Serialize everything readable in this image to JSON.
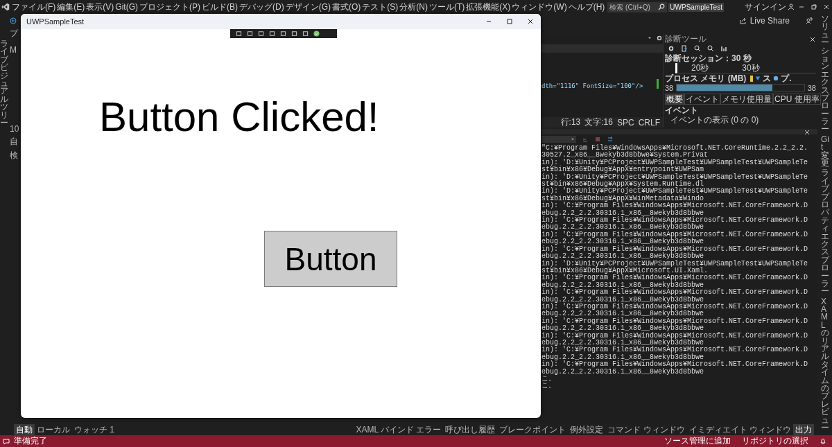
{
  "ide": {
    "menu": [
      "ファイル(F)",
      "編集(E)",
      "表示(V)",
      "Git(G)",
      "プロジェクト(P)",
      "ビルド(B)",
      "デバッグ(D)",
      "デザイン(G)",
      "書式(O)",
      "テスト(S)",
      "分析(N)",
      "ツール(T)",
      "拡張機能(X)",
      "ウィンドウ(W)",
      "ヘルプ(H)"
    ],
    "search": {
      "placeholder": "検索 (Ctrl+Q)"
    },
    "solution_name": "UWPSampleTest",
    "sign_in": "サインイン",
    "live_share": "Live Share",
    "left_tool_tab": "ライブビジュアルツリー",
    "left_fragments": [
      "プ",
      "M",
      "10",
      "自",
      "検"
    ],
    "editor": {
      "code_line": "dth=\"1116\" FontSize=\"100\"/>",
      "status": [
        "行:13",
        "文字:16",
        "SPC",
        "CRLF"
      ]
    },
    "diagnostics": {
      "title": "診断ツール",
      "session": "診断セッション：30 秒",
      "timeline_ticks": [
        "20秒",
        "30秒"
      ],
      "memory_title": "プロセス メモリ (MB)",
      "legend": [
        {
          "kind": "flag",
          "color": "#e8c43a"
        },
        {
          "kind": "triangle",
          "color": "#3c8fe0",
          "label": "ス"
        },
        {
          "kind": "circle",
          "color": "#6aaee6",
          "label": "プ."
        }
      ],
      "memory": {
        "min": "38",
        "max": "38",
        "level": 0.75
      },
      "tabs": [
        {
          "label": "概要",
          "selected": true
        },
        {
          "label": "イベント",
          "selected": false
        },
        {
          "label": "メモリ使用量",
          "selected": false
        },
        {
          "label": "CPU 使用率",
          "selected": false
        }
      ],
      "events_heading": "イベント",
      "events_link": "イベントの表示 (0 の 0)"
    },
    "output": {
      "lines": [
        "\"C:¥Program Files¥WindowsApps¥Microsoft.NET.CoreRuntime.2.2_2.2.30527.2_x86__8wekyb3d8bbwe¥System.Privat",
        "in): 'D:¥Unity¥PCProject¥UWPSampleTest¥UWPSampleTest¥UWPSampleTest¥bin¥x86¥Debug¥AppX¥entrypoint¥UWPSam",
        "in): 'D:¥Unity¥PCProject¥UWPSampleTest¥UWPSampleTest¥UWPSampleTest¥bin¥x86¥Debug¥AppX¥System.Runtime.dl",
        "in): 'D:¥Unity¥PCProject¥UWPSampleTest¥UWPSampleTest¥UWPSampleTest¥bin¥x86¥Debug¥AppX¥WinMetadata¥Windo",
        "in): 'C:¥Program Files¥WindowsApps¥Microsoft.NET.CoreFramework.Debug.2.2_2.2.30316.1_x86__8wekyb3d8bbwe",
        "in): 'C:¥Program Files¥WindowsApps¥Microsoft.NET.CoreFramework.Debug.2.2_2.2.30316.1_x86__8wekyb3d8bbwe",
        "in): 'C:¥Program Files¥WindowsApps¥Microsoft.NET.CoreFramework.Debug.2.2_2.2.30316.1_x86__8wekyb3d8bbwe",
        "in): 'C:¥Program Files¥WindowsApps¥Microsoft.NET.CoreFramework.Debug.2.2_2.2.30316.1_x86__8wekyb3d8bbwe",
        "in): 'D:¥Unity¥PCProject¥UWPSampleTest¥UWPSampleTest¥UWPSampleTest¥bin¥x86¥Debug¥AppX¥Microsoft.UI.Xaml.",
        "in): 'C:¥Program Files¥WindowsApps¥Microsoft.NET.CoreFramework.Debug.2.2_2.2.30316.1_x86__8wekyb3d8bbwe",
        "in): 'C:¥Program Files¥WindowsApps¥Microsoft.NET.CoreFramework.Debug.2.2_2.2.30316.1_x86__8wekyb3d8bbwe",
        "in): 'C:¥Program Files¥WindowsApps¥Microsoft.NET.CoreFramework.Debug.2.2_2.2.30316.1_x86__8wekyb3d8bbwe",
        "in): 'C:¥Program Files¥WindowsApps¥Microsoft.NET.CoreFramework.Debug.2.2_2.2.30316.1_x86__8wekyb3d8bbwe",
        "in): 'C:¥Program Files¥WindowsApps¥Microsoft.NET.CoreFramework.Debug.2.2_2.2.30316.1_x86__8wekyb3d8bbwe",
        "in): 'C:¥Program Files¥WindowsApps¥Microsoft.NET.CoreFramework.Debug.2.2_2.2.30316.1_x86__8wekyb3d8bbwe",
        "in): 'C:¥Program Files¥WindowsApps¥Microsoft.NET.CoreFramework.Debug.2.2_2.2.30316.1_x86__8wekyb3d8bbwe",
        "こ。",
        "こ。"
      ]
    },
    "right_tool_tabs": [
      "ソリューションエクスプローラー",
      "Git変更",
      "ライブプロパティエクスプローラー",
      "XAMLのリアルタイムのプレビュー"
    ],
    "bottom_left_tabs": [
      {
        "label": "自動",
        "selected": true
      },
      {
        "label": "ローカル",
        "selected": false
      },
      {
        "label": "ウォッチ 1",
        "selected": false
      }
    ],
    "bottom_right_tabs": [
      {
        "label": "XAML バインド エラー",
        "selected": false
      },
      {
        "label": "呼び出し履歴",
        "selected": false
      },
      {
        "label": "ブレークポイント",
        "selected": false
      },
      {
        "label": "例外設定",
        "selected": false
      },
      {
        "label": "コマンド ウィンドウ",
        "selected": false
      },
      {
        "label": "イミディエイト ウィンドウ",
        "selected": false
      },
      {
        "label": "出力",
        "selected": true
      }
    ],
    "status_bar": {
      "message": "準備完了",
      "source_control": "ソース管理に追加",
      "repository": "リポジトリの選択"
    }
  },
  "app_window": {
    "title": "UWPSampleTest",
    "message": "Button Clicked!",
    "button": "Button"
  }
}
